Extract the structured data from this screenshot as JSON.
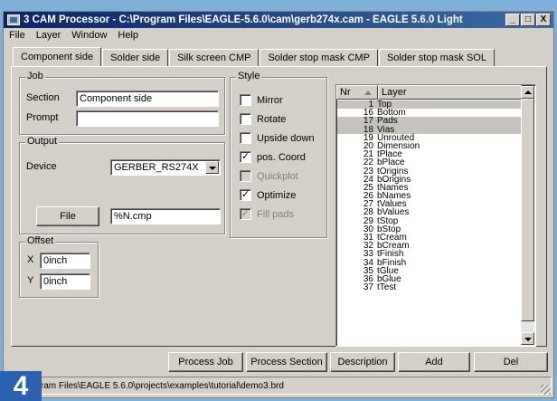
{
  "window": {
    "title": "3 CAM Processor - C:\\Program Files\\EAGLE-5.6.0\\cam\\gerb274x.cam - EAGLE 5.6.0 Light",
    "controls": [
      "_",
      "□",
      "X"
    ]
  },
  "menu": [
    "File",
    "Layer",
    "Window",
    "Help"
  ],
  "tabs": [
    "Component side",
    "Solder side",
    "Silk screen CMP",
    "Solder stop mask CMP",
    "Solder stop mask SOL"
  ],
  "job": {
    "group_label": "Job",
    "section_label": "Section",
    "section_value": "Component side",
    "prompt_label": "Prompt",
    "prompt_value": ""
  },
  "output": {
    "group_label": "Output",
    "device_label": "Device",
    "device_value": "GERBER_RS274X",
    "file_button": "File",
    "file_value": "%N.cmp"
  },
  "offset": {
    "group_label": "Offset",
    "x_label": "X",
    "x_value": "0inch",
    "y_label": "Y",
    "y_value": "0inch"
  },
  "style": {
    "group_label": "Style",
    "options": [
      {
        "label": "Mirror",
        "checked": false,
        "enabled": true
      },
      {
        "label": "Rotate",
        "checked": false,
        "enabled": true
      },
      {
        "label": "Upside down",
        "checked": false,
        "enabled": true
      },
      {
        "label": "pos. Coord",
        "checked": true,
        "enabled": true
      },
      {
        "label": "Quickplot",
        "checked": false,
        "enabled": false
      },
      {
        "label": "Optimize",
        "checked": true,
        "enabled": true
      },
      {
        "label": "Fill pads",
        "checked": true,
        "enabled": false
      }
    ]
  },
  "layers": {
    "col_nr": "Nr",
    "col_layer": "Layer",
    "rows": [
      {
        "nr": "1",
        "name": "Top",
        "selected": true
      },
      {
        "nr": "16",
        "name": "Bottom",
        "selected": false
      },
      {
        "nr": "17",
        "name": "Pads",
        "selected": true
      },
      {
        "nr": "18",
        "name": "Vias",
        "selected": true
      },
      {
        "nr": "19",
        "name": "Unrouted",
        "selected": false
      },
      {
        "nr": "20",
        "name": "Dimension",
        "selected": false
      },
      {
        "nr": "21",
        "name": "tPlace",
        "selected": false
      },
      {
        "nr": "22",
        "name": "bPlace",
        "selected": false
      },
      {
        "nr": "23",
        "name": "tOrigins",
        "selected": false
      },
      {
        "nr": "24",
        "name": "bOrigins",
        "selected": false
      },
      {
        "nr": "25",
        "name": "tNames",
        "selected": false
      },
      {
        "nr": "26",
        "name": "bNames",
        "selected": false
      },
      {
        "nr": "27",
        "name": "tValues",
        "selected": false
      },
      {
        "nr": "28",
        "name": "bValues",
        "selected": false
      },
      {
        "nr": "29",
        "name": "tStop",
        "selected": false
      },
      {
        "nr": "30",
        "name": "bStop",
        "selected": false
      },
      {
        "nr": "31",
        "name": "tCream",
        "selected": false
      },
      {
        "nr": "32",
        "name": "bCream",
        "selected": false
      },
      {
        "nr": "33",
        "name": "tFinish",
        "selected": false
      },
      {
        "nr": "34",
        "name": "bFinish",
        "selected": false
      },
      {
        "nr": "35",
        "name": "tGlue",
        "selected": false
      },
      {
        "nr": "36",
        "name": "bGlue",
        "selected": false
      },
      {
        "nr": "37",
        "name": "tTest",
        "selected": false
      }
    ]
  },
  "buttons": {
    "process_job": "Process Job",
    "process_section": "Process Section",
    "description": "Description",
    "add": "Add",
    "del": "Del"
  },
  "status": "C:\\Program Files\\EAGLE 5.6.0\\projects\\examples\\tutorial\\demo3.brd",
  "badge": "4"
}
